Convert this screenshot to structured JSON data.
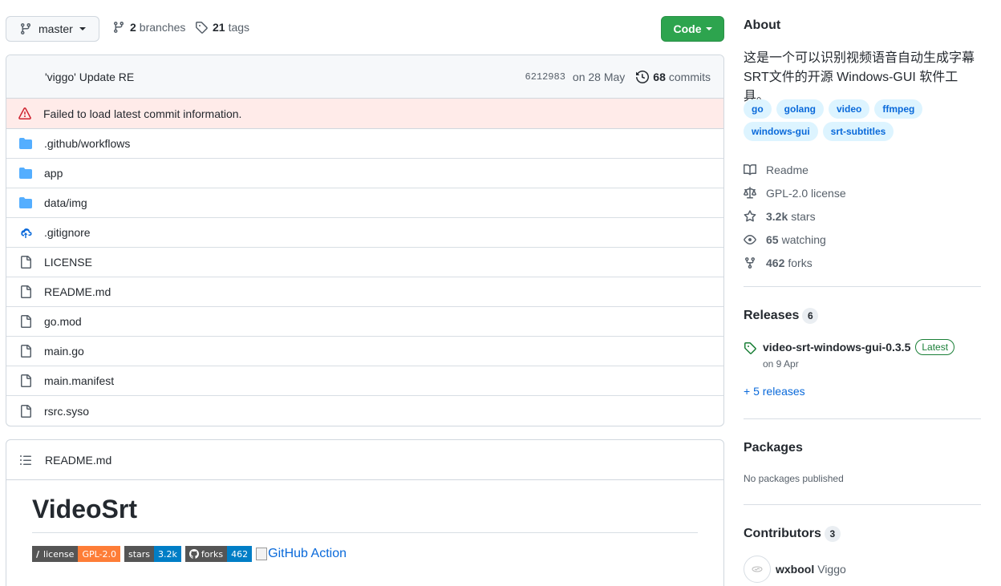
{
  "branch_button": {
    "label": "master"
  },
  "branches": {
    "count": "2",
    "label": "branches"
  },
  "tags": {
    "count": "21",
    "label": "tags"
  },
  "code_button": {
    "label": "Code"
  },
  "commit": {
    "author": "'viggo'",
    "message": "Update RE",
    "sha": "6212983",
    "date": "on 28 May",
    "count": "68",
    "count_label": "commits"
  },
  "error": {
    "text": "Failed to load latest commit information."
  },
  "files": [
    {
      "name": ".github/workflows",
      "type": "folder"
    },
    {
      "name": "app",
      "type": "folder"
    },
    {
      "name": "data/img",
      "type": "folder"
    },
    {
      "name": ".gitignore",
      "type": "cloud-file"
    },
    {
      "name": "LICENSE",
      "type": "file"
    },
    {
      "name": "README.md",
      "type": "file"
    },
    {
      "name": "go.mod",
      "type": "file"
    },
    {
      "name": "main.go",
      "type": "file"
    },
    {
      "name": "main.manifest",
      "type": "file"
    },
    {
      "name": "rsrc.syso",
      "type": "file"
    }
  ],
  "readme": {
    "header": "README.md",
    "title": "VideoSrt",
    "badges": [
      {
        "left": "license",
        "right": "GPL-2.0",
        "color": "#fe7d37"
      },
      {
        "left": "stars",
        "right": "3.2k",
        "color": "#007ec6"
      },
      {
        "left": "forks",
        "right": "462",
        "color": "#007ec6"
      }
    ],
    "action_alt": "GitHub Action"
  },
  "about": {
    "title": "About",
    "description": "这是一个可以识别视频语音自动生成字幕SRT文件的开源 Windows-GUI 软件工具。",
    "topics": [
      "go",
      "golang",
      "video",
      "ffmpeg",
      "windows-gui",
      "srt-subtitles"
    ],
    "readme": "Readme",
    "license": "GPL-2.0 license",
    "stars_count": "3.2k",
    "stars_label": "stars",
    "watching_count": "65",
    "watching_label": "watching",
    "forks_count": "462",
    "forks_label": "forks"
  },
  "releases": {
    "title": "Releases",
    "count": "6",
    "latest_name": "video-srt-windows-gui-0.3.5",
    "latest_badge": "Latest",
    "latest_date": "on 9 Apr",
    "more": "+ 5 releases"
  },
  "packages": {
    "title": "Packages",
    "empty": "No packages published"
  },
  "contributors": {
    "title": "Contributors",
    "count": "3",
    "first_login": "wxbool",
    "first_name": "Viggo"
  },
  "colors": {
    "accent": "#0969da",
    "green": "#2da44e",
    "error_bg": "#ffebe9",
    "folder": "#54aeff"
  }
}
